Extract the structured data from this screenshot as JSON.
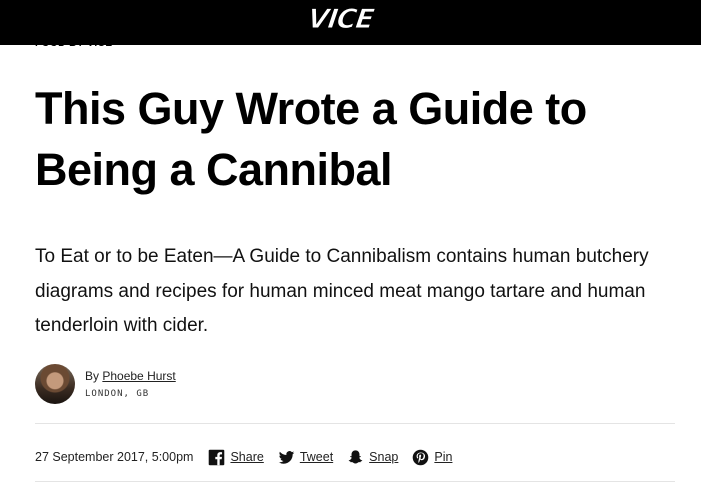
{
  "header": {
    "logo_text": "VICE",
    "background": "#000000"
  },
  "article": {
    "section_label": "FOOD BY VICE",
    "headline": "This Guy Wrote a Guide to Being a Cannibal",
    "dek": "To Eat or to be Eaten—A Guide to Cannibalism contains human butchery diagrams and recipes for human minced meat mango tartare and human tenderloin with cider.",
    "byline": {
      "prefix": "By",
      "author": "Phoebe Hurst",
      "location": "LONDON, GB"
    },
    "date": "27 September 2017, 5:00pm",
    "share": [
      {
        "label": "Share",
        "icon": "facebook-icon"
      },
      {
        "label": "Tweet",
        "icon": "twitter-icon"
      },
      {
        "label": "Snap",
        "icon": "snapchat-icon"
      },
      {
        "label": "Pin",
        "icon": "pinterest-icon"
      }
    ]
  }
}
